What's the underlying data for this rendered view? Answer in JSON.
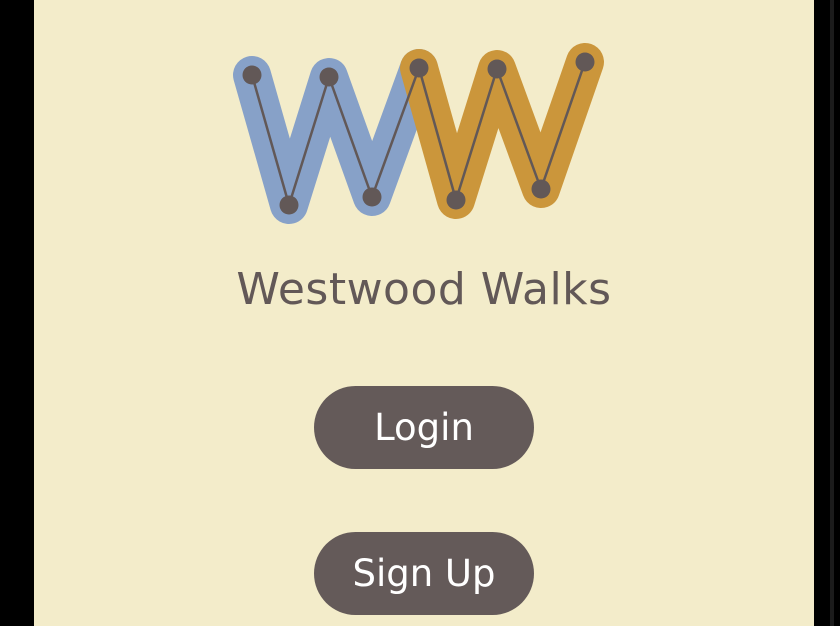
{
  "app": {
    "title": "Westwood Walks"
  },
  "actions": {
    "login_label": "Login",
    "signup_label": "Sign Up"
  },
  "logo": {
    "icon": "westwood-walks-ww-logo",
    "text": "WW"
  },
  "colors": {
    "background": "#f3ecca",
    "text": "#625857",
    "button": "#645a59",
    "button_text": "#ffffff",
    "logo_blue": "#87a1c8",
    "logo_gold": "#cb963b",
    "logo_node": "#625857"
  }
}
